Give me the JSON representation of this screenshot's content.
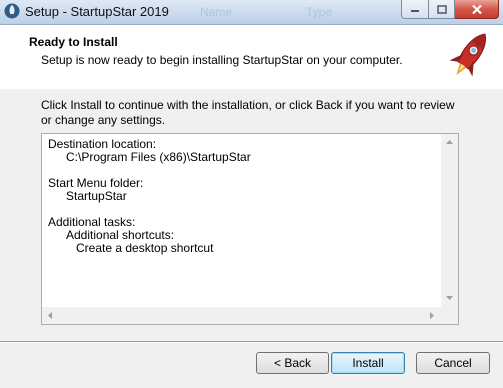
{
  "window": {
    "title": "Setup - StartupStar 2019",
    "background_text": [
      "Name",
      "Type"
    ]
  },
  "icons": {
    "app": "rocket-app-icon",
    "header": "rocket-logo-icon",
    "minimize": "minimize-icon",
    "maximize": "maximize-icon",
    "close": "close-icon"
  },
  "header": {
    "title": "Ready to Install",
    "subtitle": "Setup is now ready to begin installing StartupStar on your computer."
  },
  "body": {
    "intro": "Click Install to continue with the installation, or click Back if you want to review or change any settings."
  },
  "memo": {
    "destination_label": "Destination location:",
    "destination_value": "C:\\Program Files (x86)\\StartupStar",
    "start_menu_label": "Start Menu folder:",
    "start_menu_value": "StartupStar",
    "tasks_label": "Additional tasks:",
    "shortcuts_label": "Additional shortcuts:",
    "shortcut_item": "Create a desktop shortcut"
  },
  "buttons": {
    "back": "< Back",
    "install": "Install",
    "cancel": "Cancel"
  },
  "colors": {
    "close_button": "#c94a3d",
    "default_button_border": "#3c7fb1",
    "rocket_body": "#c62f2a"
  }
}
